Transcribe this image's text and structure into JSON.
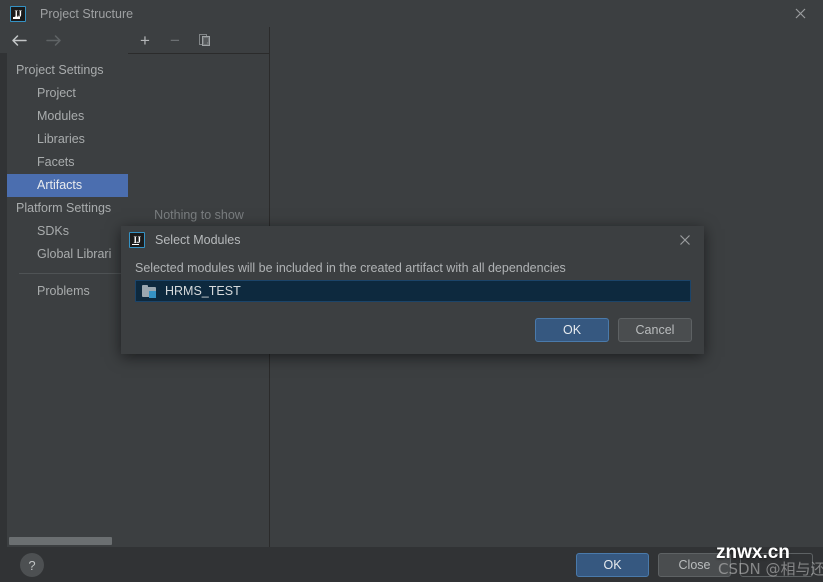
{
  "window": {
    "title": "Project Structure",
    "app_icon": "intellij-idea-icon",
    "close_icon": "close-icon"
  },
  "navbar": {
    "back_icon": "arrow-left-icon",
    "forward_icon": "arrow-right-icon"
  },
  "sidebar": {
    "groups": [
      {
        "label": "Project Settings",
        "items": [
          {
            "label": "Project",
            "selected": false
          },
          {
            "label": "Modules",
            "selected": false
          },
          {
            "label": "Libraries",
            "selected": false
          },
          {
            "label": "Facets",
            "selected": false
          },
          {
            "label": "Artifacts",
            "selected": true
          }
        ]
      },
      {
        "label": "Platform Settings",
        "items": [
          {
            "label": "SDKs",
            "selected": false
          },
          {
            "label": "Global Librari",
            "selected": false
          }
        ]
      }
    ],
    "footer_items": [
      {
        "label": "Problems",
        "selected": false
      }
    ]
  },
  "center_panel": {
    "toolbar": {
      "add_icon": "plus-icon",
      "remove_icon": "minus-icon",
      "copy_icon": "copy-icon"
    },
    "empty_text": "Nothing to show"
  },
  "bottom_bar": {
    "help_icon": "question-mark-icon",
    "help_label": "?",
    "buttons": [
      {
        "label": "OK",
        "style": "primary"
      },
      {
        "label": "Close",
        "style": "default"
      },
      {
        "label": "",
        "style": "default"
      }
    ]
  },
  "dialog": {
    "title": "Select Modules",
    "app_icon": "intellij-idea-icon",
    "close_icon": "close-icon",
    "description": "Selected modules will be included in the created artifact with all dependencies",
    "list": [
      {
        "label": "HRMS_TEST",
        "icon": "module-folder-icon",
        "selected": true
      }
    ],
    "buttons": [
      {
        "label": "OK",
        "style": "primary"
      },
      {
        "label": "Cancel",
        "style": "default"
      }
    ]
  },
  "watermark": {
    "primary": "znwx.cn",
    "secondary": "CSDN @相与还"
  },
  "colors": {
    "window_bg": "#313335",
    "panel_bg": "#3c3f41",
    "selection_blue": "#4b6eaf",
    "primary_button": "#365880",
    "list_selection": "#0d293e",
    "accent_icon": "#3592c4",
    "text": "#a9acad"
  }
}
